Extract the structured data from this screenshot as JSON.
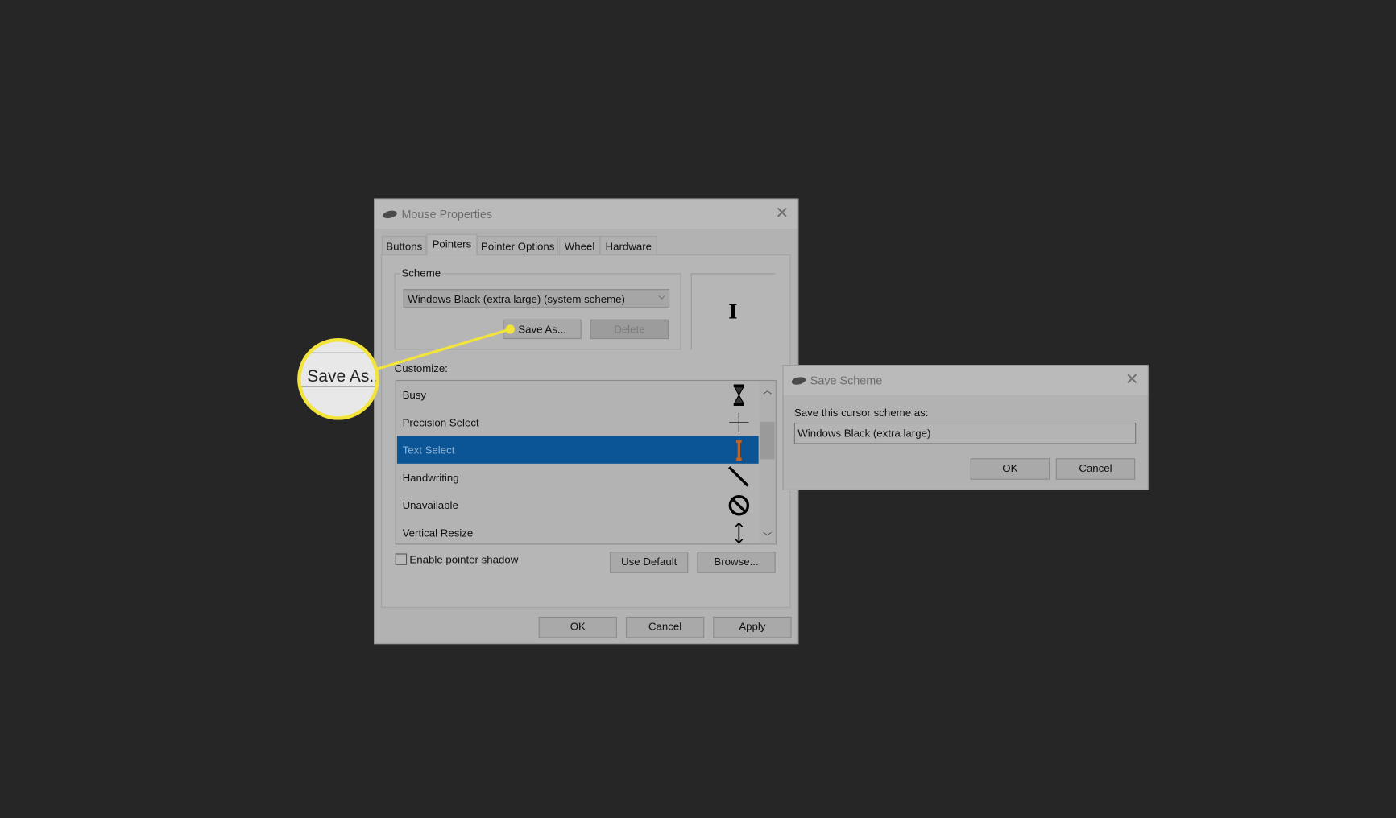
{
  "mouse_properties": {
    "title": "Mouse Properties",
    "tabs": [
      {
        "label": "Buttons",
        "selected": false
      },
      {
        "label": "Pointers",
        "selected": true
      },
      {
        "label": "Pointer Options",
        "selected": false
      },
      {
        "label": "Wheel",
        "selected": false
      },
      {
        "label": "Hardware",
        "selected": false
      }
    ],
    "scheme": {
      "legend": "Scheme",
      "selected": "Windows Black (extra large) (system scheme)",
      "save_as": "Save As...",
      "delete": "Delete"
    },
    "customize": {
      "label": "Customize:",
      "items": [
        {
          "label": "Busy",
          "icon": "hourglass-icon"
        },
        {
          "label": "Precision Select",
          "icon": "crosshair-icon"
        },
        {
          "label": "Text Select",
          "icon": "text-beam-icon",
          "selected": true
        },
        {
          "label": "Handwriting",
          "icon": "pen-icon"
        },
        {
          "label": "Unavailable",
          "icon": "unavailable-icon"
        },
        {
          "label": "Vertical Resize",
          "icon": "vertical-resize-icon"
        }
      ]
    },
    "enable_shadow": {
      "label": "Enable pointer shadow",
      "checked": false
    },
    "use_default": "Use Default",
    "browse": "Browse...",
    "ok": "OK",
    "cancel": "Cancel",
    "apply": "Apply"
  },
  "save_scheme": {
    "title": "Save Scheme",
    "prompt": "Save this cursor scheme as:",
    "value": "Windows Black (extra large)",
    "ok": "OK",
    "cancel": "Cancel"
  },
  "callout": {
    "text": "Save As..",
    "color": "#f2e43a"
  },
  "colors": {
    "background": "#262626",
    "selection": "#0b5597"
  }
}
